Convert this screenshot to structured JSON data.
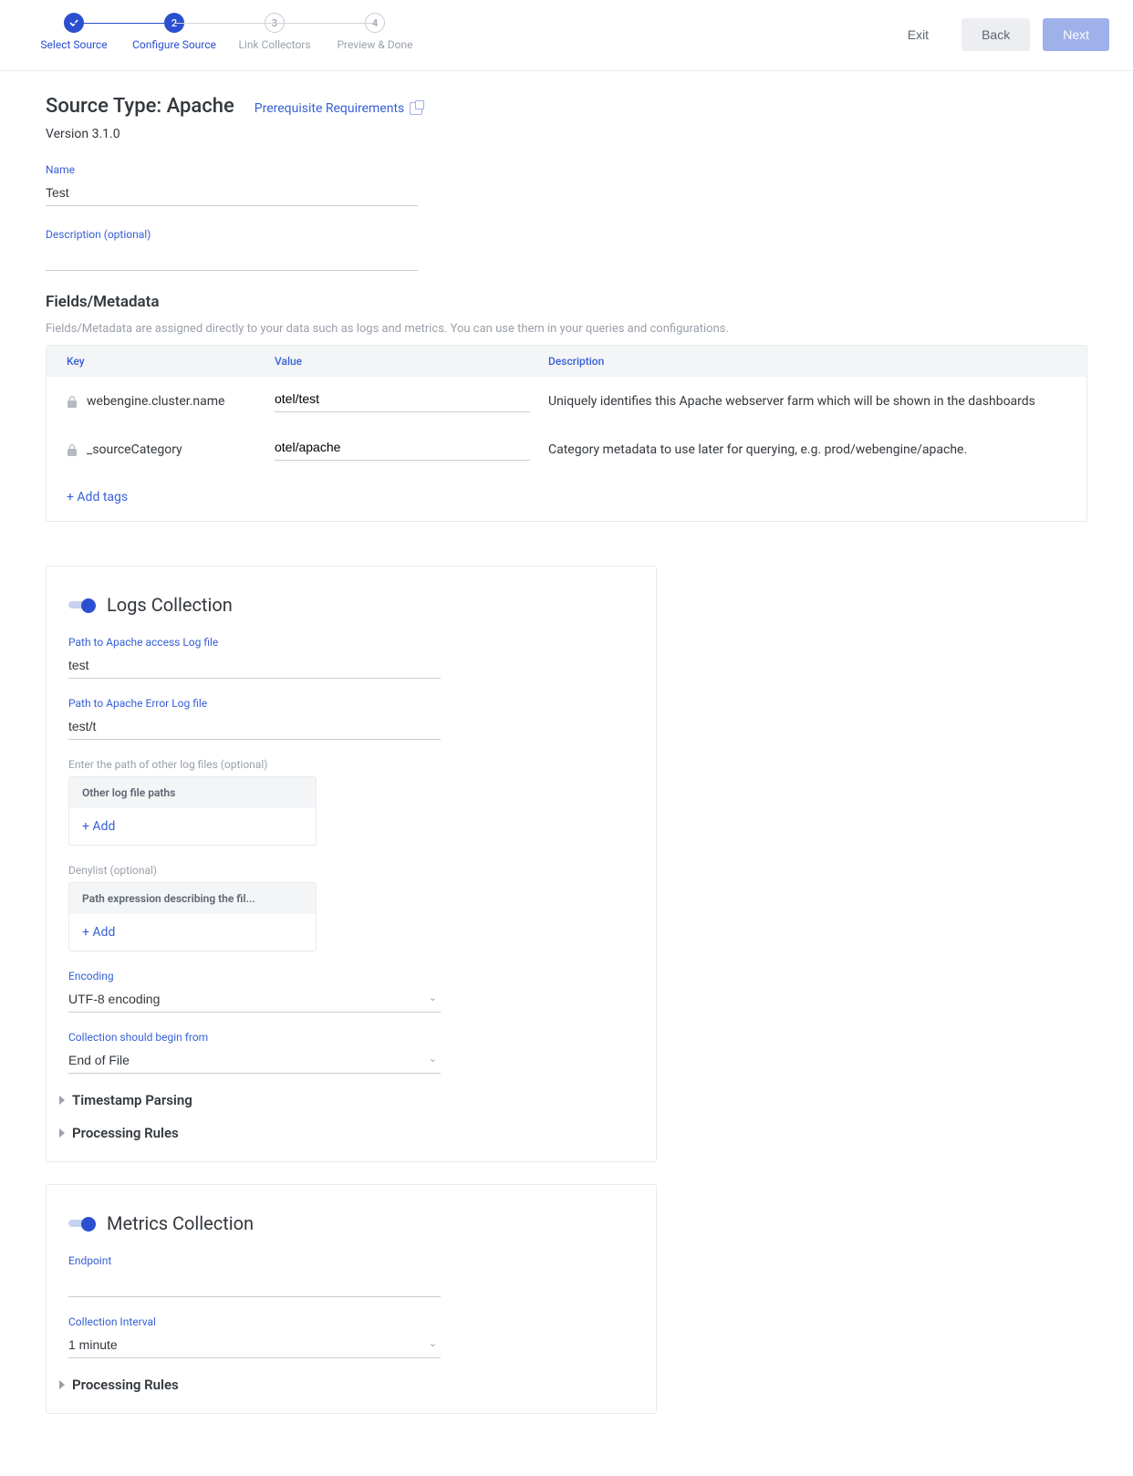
{
  "stepper": {
    "steps": [
      {
        "label": "Select Source",
        "state": "complete",
        "display": "✓"
      },
      {
        "label": "Configure Source",
        "state": "active",
        "display": "2"
      },
      {
        "label": "Link Collectors",
        "state": "pending",
        "display": "3"
      },
      {
        "label": "Preview & Done",
        "state": "pending",
        "display": "4"
      }
    ]
  },
  "actions": {
    "exit": "Exit",
    "back": "Back",
    "next": "Next"
  },
  "header": {
    "title": "Source Type: Apache",
    "prereq": "Prerequisite Requirements",
    "version": "Version 3.1.0"
  },
  "name_field": {
    "label": "Name",
    "value": "Test"
  },
  "desc_field": {
    "label": "Description (optional)",
    "value": ""
  },
  "meta": {
    "section_title": "Fields/Metadata",
    "hint": "Fields/Metadata are assigned directly to your data such as logs and metrics. You can use them in your queries and configurations.",
    "head": {
      "key": "Key",
      "value": "Value",
      "desc": "Description"
    },
    "rows": [
      {
        "key": "webengine.cluster.name",
        "value": "otel/test",
        "desc": "Uniquely identifies this Apache webserver farm which will be shown in the dashboards"
      },
      {
        "key": "_sourceCategory",
        "value": "otel/apache",
        "desc": "Category metadata to use later for querying, e.g. prod/webengine/apache."
      }
    ],
    "add_tags": "+ Add tags"
  },
  "logs": {
    "title": "Logs Collection",
    "access": {
      "label": "Path to Apache access Log file",
      "value": "test"
    },
    "error": {
      "label": "Path to Apache Error Log file",
      "value": "test/t"
    },
    "other": {
      "label": "Enter the path of other log files (optional)",
      "head": "Other log file paths",
      "add": "+ Add"
    },
    "deny": {
      "label": "Denylist (optional)",
      "head": "Path expression describing the fil...",
      "add": "+ Add"
    },
    "encoding": {
      "label": "Encoding",
      "value": "UTF-8 encoding"
    },
    "begin": {
      "label": "Collection should begin from",
      "value": "End of File"
    },
    "timestamp": "Timestamp Parsing",
    "rules": "Processing Rules"
  },
  "metrics": {
    "title": "Metrics Collection",
    "endpoint": {
      "label": "Endpoint",
      "value": ""
    },
    "interval": {
      "label": "Collection Interval",
      "value": "1 minute"
    },
    "rules": "Processing Rules"
  }
}
